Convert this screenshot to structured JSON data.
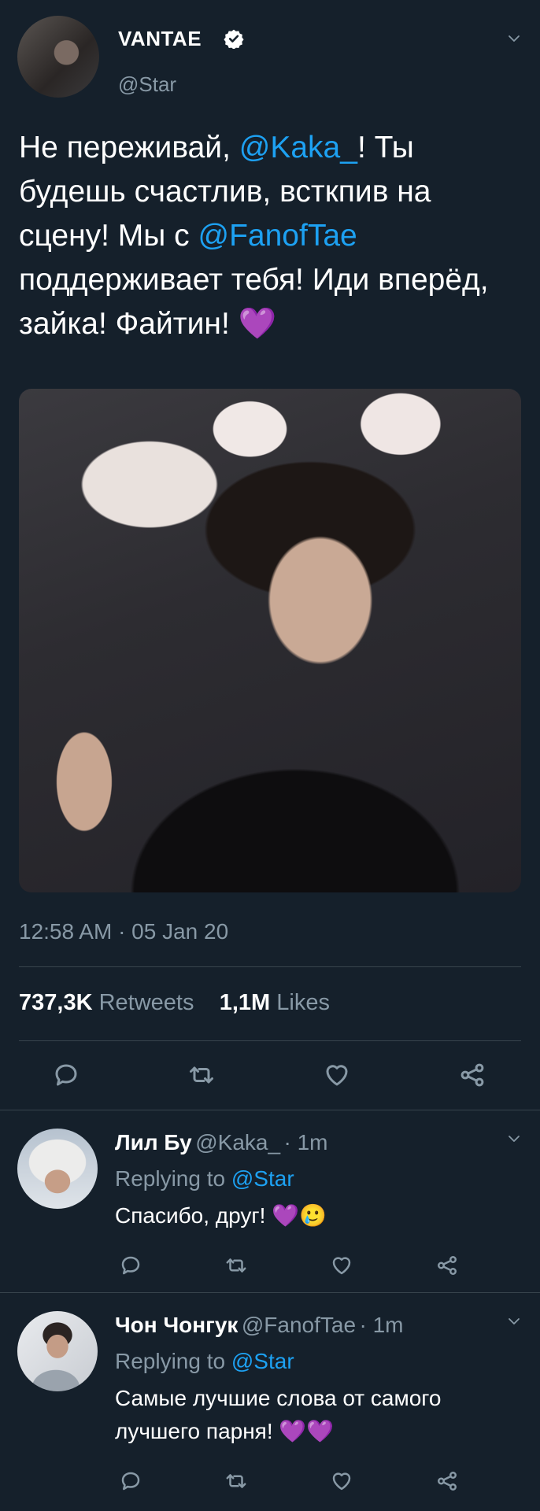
{
  "tweet": {
    "display_name": "VANTAE",
    "handle": "@Star",
    "text_parts": [
      {
        "text": "Не переживай, ",
        "link": false
      },
      {
        "text": "@Kaka_",
        "link": true
      },
      {
        "text": "! Ты будешь счастлив, всткпив на сцену! Мы с ",
        "link": false
      },
      {
        "text": "@FanofTae",
        "link": true
      },
      {
        "text": " поддерживает тебя! Иди вперёд, зайка! Файтин! 💜",
        "link": false
      }
    ],
    "timestamp": "12:58 AM · 05 Jan 20",
    "retweets_count": "737,3K",
    "retweets_label": "Retweets",
    "likes_count": "1,1M",
    "likes_label": "Likes"
  },
  "replies": [
    {
      "name": "Лил Бу",
      "handle": "@Kaka_",
      "time": "· 1m",
      "replying_prefix": "Replying to",
      "replying_to": "@Star",
      "text": "Спасибо, друг! 💜🥲"
    },
    {
      "name": "Чон Чонгук",
      "handle": "@FanofTae",
      "time": "· 1m",
      "replying_prefix": "Replying to",
      "replying_to": "@Star",
      "text": "Самые лучшие слова от самого лучшего парня! 💜💜"
    }
  ],
  "icons": {
    "reply": "reply-icon",
    "retweet": "retweet-icon",
    "like": "heart-icon",
    "share": "share-icon",
    "menu": "chevron-down-icon",
    "verified": "verified-badge-icon"
  },
  "colors": {
    "background": "#15202b",
    "accent": "#1da1f2",
    "muted": "#8899a6",
    "divider": "#38444d"
  }
}
